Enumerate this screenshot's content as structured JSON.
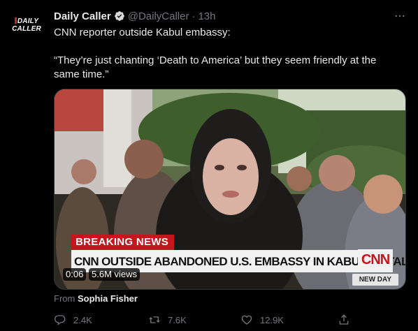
{
  "author": {
    "logo_line1": "DAILY",
    "logo_line2": "CALLER",
    "name": "Daily Caller",
    "handle": "@DailyCaller",
    "separator": "·",
    "time": "13h"
  },
  "tweet": {
    "line1": "CNN reporter outside Kabul embassy:",
    "line2": "“They’re just chanting ‘Death to America’ but they seem friendly at the same time.”"
  },
  "media": {
    "breaking_label": "BREAKING NEWS",
    "headline": "CNN OUTSIDE ABANDONED U.S. EMBASSY IN KABUL AS TALIBAN TAKE OVER",
    "network_logo": "CNN",
    "show_tag": "NEW DAY",
    "time_chip": "0:06",
    "views_chip": "5.6M views"
  },
  "attribution": {
    "prefix": "From",
    "name": "Sophia Fisher"
  },
  "actions": {
    "reply_count": "2.4K",
    "retweet_count": "7.6K",
    "like_count": "12.9K"
  },
  "icons": {
    "verified": "verified-badge-icon",
    "more": "more-icon",
    "reply": "reply-icon",
    "retweet": "retweet-icon",
    "like": "heart-icon",
    "share": "share-icon"
  },
  "colors": {
    "background": "#000000",
    "text_primary": "#e7e9ea",
    "text_secondary": "#71767b",
    "cnn_red": "#c4161c"
  }
}
